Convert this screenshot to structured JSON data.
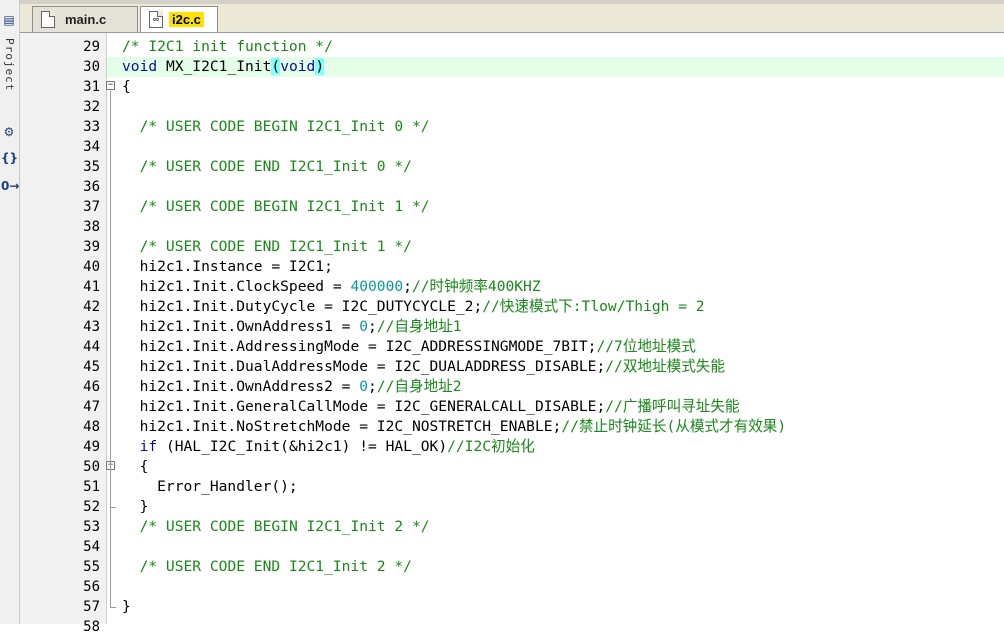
{
  "left_panel": {
    "project_label": "Project",
    "icons": [
      "project-tree-icon",
      "books-icon",
      "functions-icon",
      "templates-icon"
    ]
  },
  "tabs": [
    {
      "label": "main.c",
      "active": false
    },
    {
      "label": "i2c.c",
      "active": true
    }
  ],
  "editor": {
    "lines": [
      {
        "n": "29",
        "html": "<span class=\"c\">/* I2C1 init function */</span>"
      },
      {
        "n": "30",
        "html": "<span class=\"kw\">void</span> MX_I2C1_Init<span class=\"bm\">(</span><span class=\"kw\">void</span><span class=\"bm\">)</span>",
        "highlight": true
      },
      {
        "n": "31",
        "html": "{",
        "fold": "-"
      },
      {
        "n": "32",
        "html": ""
      },
      {
        "n": "33",
        "html": "  <span class=\"c\">/* USER CODE BEGIN I2C1_Init 0 */</span>"
      },
      {
        "n": "34",
        "html": ""
      },
      {
        "n": "35",
        "html": "  <span class=\"c\">/* USER CODE END I2C1_Init 0 */</span>"
      },
      {
        "n": "36",
        "html": ""
      },
      {
        "n": "37",
        "html": "  <span class=\"c\">/* USER CODE BEGIN I2C1_Init 1 */</span>"
      },
      {
        "n": "38",
        "html": ""
      },
      {
        "n": "39",
        "html": "  <span class=\"c\">/* USER CODE END I2C1_Init 1 */</span>"
      },
      {
        "n": "40",
        "html": "  hi2c1.Instance = I2C1;"
      },
      {
        "n": "41",
        "html": "  hi2c1.Init.ClockSpeed = <span class=\"num\">400000</span>;<span class=\"c\">//时钟频率400KHZ</span>"
      },
      {
        "n": "42",
        "html": "  hi2c1.Init.DutyCycle = I2C_DUTYCYCLE_2;<span class=\"c\">//快速模式下:Tlow/Thigh = 2</span>"
      },
      {
        "n": "43",
        "html": "  hi2c1.Init.OwnAddress1 = <span class=\"num\">0</span>;<span class=\"c\">//自身地址1</span>"
      },
      {
        "n": "44",
        "html": "  hi2c1.Init.AddressingMode = I2C_ADDRESSINGMODE_7BIT;<span class=\"c\">//7位地址模式</span>"
      },
      {
        "n": "45",
        "html": "  hi2c1.Init.DualAddressMode = I2C_DUALADDRESS_DISABLE;<span class=\"c\">//双地址模式失能</span>"
      },
      {
        "n": "46",
        "html": "  hi2c1.Init.OwnAddress2 = <span class=\"num\">0</span>;<span class=\"c\">//自身地址2</span>"
      },
      {
        "n": "47",
        "html": "  hi2c1.Init.GeneralCallMode = I2C_GENERALCALL_DISABLE;<span class=\"c\">//广播呼叫寻址失能</span>"
      },
      {
        "n": "48",
        "html": "  hi2c1.Init.NoStretchMode = I2C_NOSTRETCH_ENABLE;<span class=\"c\">//禁止时钟延长(从模式才有效果)</span>"
      },
      {
        "n": "49",
        "html": "  <span class=\"kw\">if</span> (HAL_I2C_Init(&amp;hi2c1) != HAL_OK)<span class=\"c\">//I2C初始化</span>"
      },
      {
        "n": "50",
        "html": "  {",
        "fold": "-"
      },
      {
        "n": "51",
        "html": "    Error_Handler();"
      },
      {
        "n": "52",
        "html": "  }"
      },
      {
        "n": "53",
        "html": "  <span class=\"c\">/* USER CODE BEGIN I2C1_Init 2 */</span>"
      },
      {
        "n": "54",
        "html": ""
      },
      {
        "n": "55",
        "html": "  <span class=\"c\">/* USER CODE END I2C1_Init 2 */</span>"
      },
      {
        "n": "56",
        "html": ""
      },
      {
        "n": "57",
        "html": "}"
      },
      {
        "n": "58",
        "html": ""
      }
    ]
  }
}
